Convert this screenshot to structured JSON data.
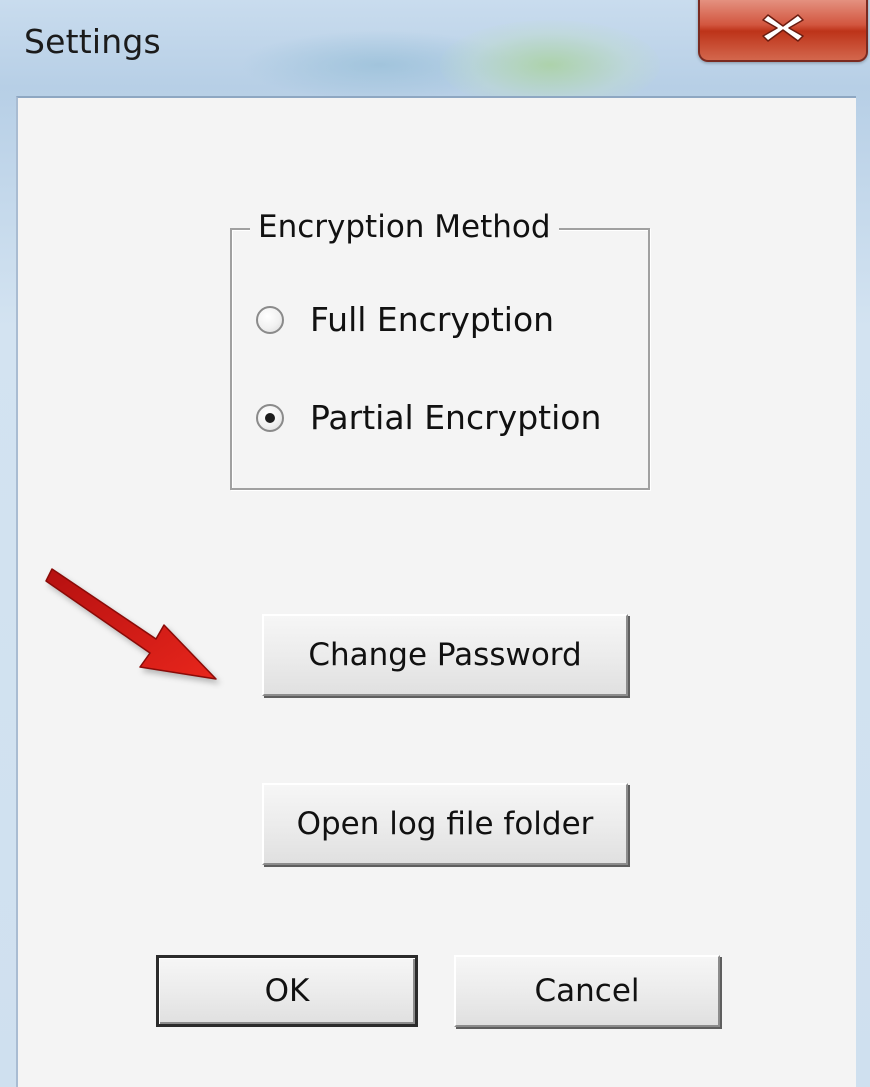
{
  "window": {
    "title": "Settings"
  },
  "encryption": {
    "group_label": "Encryption Method",
    "options": [
      {
        "label": "Full Encryption",
        "selected": false
      },
      {
        "label": "Partial Encryption",
        "selected": true
      }
    ]
  },
  "buttons": {
    "change_password": "Change Password",
    "open_log_folder": "Open log file folder",
    "ok": "OK",
    "cancel": "Cancel"
  },
  "icons": {
    "close": "close-icon",
    "annotation": "red-arrow-icon"
  },
  "colors": {
    "close_button": "#c8402a",
    "annotation_arrow": "#d11a14"
  }
}
